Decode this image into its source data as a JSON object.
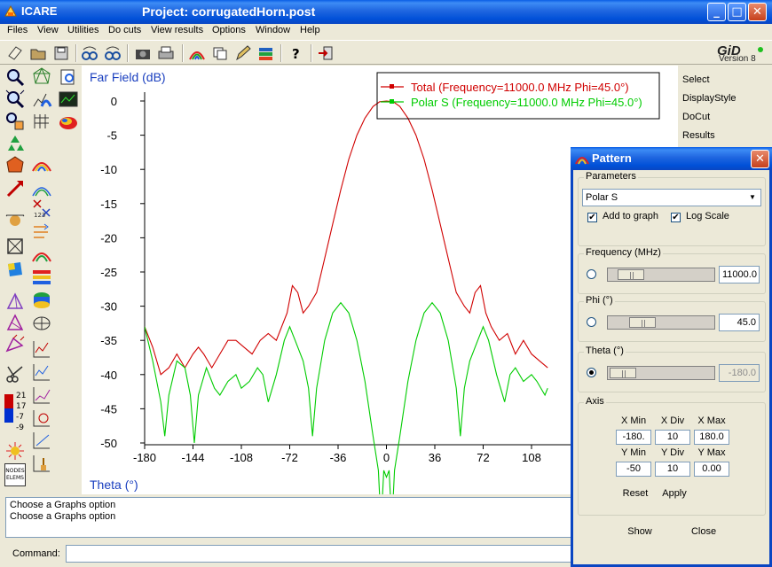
{
  "window": {
    "app_name": "ICARE",
    "project_title": "Project: corrugatedHorn.post",
    "minimize": "_",
    "maximize": "□",
    "close": "✕"
  },
  "menu": [
    "Files",
    "View",
    "Utilities",
    "Do cuts",
    "View results",
    "Options",
    "Window",
    "Help"
  ],
  "logo": {
    "brand": "GiD",
    "version": "Version 8"
  },
  "right_commands": [
    "Select",
    "DisplayStyle",
    "DoCut",
    "Results"
  ],
  "palette_labels": {
    "max": "21",
    "mid": "17",
    "low": "-7",
    "min": "-9",
    "nodes": "NODES",
    "elems": "ELEMS"
  },
  "chart_data": {
    "type": "line",
    "ylabel": "Far Field (dB)",
    "xlabel": "Theta (°)",
    "xlim": [
      -180,
      120
    ],
    "ylim": [
      -50,
      0
    ],
    "xticks": [
      -180,
      -144,
      -108,
      -72,
      -36,
      0,
      36,
      72,
      108
    ],
    "yticks": [
      0,
      -5,
      -10,
      -15,
      -20,
      -25,
      -30,
      -35,
      -40,
      -45,
      -50
    ],
    "legend_position": "top-center",
    "series": [
      {
        "name": "Total (Frequency=11000.0 MHz Phi=45.0°)",
        "color": "#d00000",
        "points": [
          [
            -180,
            -33
          ],
          [
            -174,
            -36
          ],
          [
            -168,
            -40
          ],
          [
            -162,
            -39
          ],
          [
            -156,
            -37
          ],
          [
            -150,
            -39
          ],
          [
            -144,
            -37
          ],
          [
            -140,
            -36
          ],
          [
            -136,
            -37
          ],
          [
            -130,
            -39
          ],
          [
            -124,
            -37
          ],
          [
            -118,
            -35
          ],
          [
            -112,
            -35
          ],
          [
            -106,
            -36
          ],
          [
            -100,
            -37
          ],
          [
            -94,
            -35
          ],
          [
            -88,
            -34
          ],
          [
            -82,
            -35
          ],
          [
            -78,
            -33
          ],
          [
            -74,
            -31
          ],
          [
            -70,
            -27
          ],
          [
            -66,
            -28
          ],
          [
            -62,
            -31
          ],
          [
            -58,
            -30
          ],
          [
            -52,
            -28
          ],
          [
            -46,
            -23
          ],
          [
            -40,
            -18
          ],
          [
            -34,
            -13
          ],
          [
            -28,
            -8.5
          ],
          [
            -22,
            -5
          ],
          [
            -16,
            -2.5
          ],
          [
            -10,
            -0.8
          ],
          [
            -5,
            -0.1
          ],
          [
            0,
            0
          ],
          [
            5,
            -0.1
          ],
          [
            10,
            -0.8
          ],
          [
            16,
            -2.5
          ],
          [
            22,
            -5
          ],
          [
            28,
            -8.5
          ],
          [
            34,
            -13
          ],
          [
            40,
            -18
          ],
          [
            46,
            -23
          ],
          [
            52,
            -28
          ],
          [
            58,
            -30
          ],
          [
            62,
            -31
          ],
          [
            66,
            -28
          ],
          [
            70,
            -27
          ],
          [
            74,
            -31
          ],
          [
            78,
            -33
          ],
          [
            84,
            -35
          ],
          [
            90,
            -34
          ],
          [
            96,
            -37
          ],
          [
            102,
            -35
          ],
          [
            108,
            -37
          ],
          [
            114,
            -38
          ],
          [
            120,
            -39
          ]
        ]
      },
      {
        "name": "Polar S (Frequency=11000.0 MHz Phi=45.0°)",
        "color": "#00cc00",
        "points": [
          [
            -180,
            -33
          ],
          [
            -174,
            -38
          ],
          [
            -168,
            -44
          ],
          [
            -165,
            -49
          ],
          [
            -162,
            -43
          ],
          [
            -156,
            -38
          ],
          [
            -150,
            -39
          ],
          [
            -146,
            -43
          ],
          [
            -143,
            -50
          ],
          [
            -140,
            -43
          ],
          [
            -134,
            -39
          ],
          [
            -128,
            -42
          ],
          [
            -124,
            -43
          ],
          [
            -118,
            -41
          ],
          [
            -112,
            -40
          ],
          [
            -108,
            -42
          ],
          [
            -102,
            -41
          ],
          [
            -96,
            -39
          ],
          [
            -92,
            -40
          ],
          [
            -88,
            -44
          ],
          [
            -82,
            -40
          ],
          [
            -76,
            -35
          ],
          [
            -72,
            -33
          ],
          [
            -68,
            -35
          ],
          [
            -62,
            -38
          ],
          [
            -58,
            -42
          ],
          [
            -55,
            -49
          ],
          [
            -52,
            -42
          ],
          [
            -46,
            -35
          ],
          [
            -40,
            -31
          ],
          [
            -34,
            -29.5
          ],
          [
            -28,
            -31
          ],
          [
            -22,
            -35
          ],
          [
            -16,
            -41
          ],
          [
            -10,
            -49
          ],
          [
            -6,
            -54
          ],
          [
            -4,
            -62
          ],
          [
            -2,
            -54
          ],
          [
            0,
            -55
          ],
          [
            2,
            -54
          ],
          [
            4,
            -62
          ],
          [
            6,
            -54
          ],
          [
            10,
            -49
          ],
          [
            16,
            -41
          ],
          [
            22,
            -35
          ],
          [
            28,
            -31
          ],
          [
            34,
            -29.5
          ],
          [
            40,
            -31
          ],
          [
            46,
            -35
          ],
          [
            52,
            -42
          ],
          [
            55,
            -49
          ],
          [
            58,
            -42
          ],
          [
            62,
            -38
          ],
          [
            68,
            -35
          ],
          [
            72,
            -33
          ],
          [
            76,
            -35
          ],
          [
            82,
            -40
          ],
          [
            88,
            -44
          ],
          [
            92,
            -40
          ],
          [
            96,
            -39
          ],
          [
            102,
            -41
          ],
          [
            108,
            -40
          ],
          [
            112,
            -41
          ],
          [
            118,
            -43
          ],
          [
            120,
            -42
          ]
        ]
      }
    ]
  },
  "messages": [
    "Choose a Graphs option",
    "Choose a Graphs option"
  ],
  "command": {
    "label": "Command:",
    "value": ""
  },
  "dialog": {
    "title": "Pattern",
    "close": "✕",
    "parameters_label": "Parameters",
    "parameter_selected": "Polar S",
    "add_to_graph_label": "Add to graph",
    "add_to_graph_checked": true,
    "log_scale_label": "Log Scale",
    "log_scale_checked": true,
    "frequency": {
      "label": "Frequency (MHz)",
      "value": "11000.0",
      "slider_fraction": 0.1
    },
    "phi": {
      "label": "Phi (°)",
      "value": "45.0",
      "slider_fraction": 0.25
    },
    "theta": {
      "label": "Theta (°)",
      "value": "-180.0",
      "slider_fraction": 0.0,
      "selected": true
    },
    "axis": {
      "label": "Axis",
      "xmin_label": "X Min",
      "xdiv_label": "X Div",
      "xmax_label": "X Max",
      "xmin": "-180.",
      "xdiv": "10",
      "xmax": "180.0",
      "ymin_label": "Y Min",
      "ydiv_label": "Y Div",
      "ymax_label": "Y Max",
      "ymin": "-50",
      "ydiv": "10",
      "ymax": "0.00"
    },
    "reset_label": "Reset",
    "apply_label": "Apply",
    "show_label": "Show",
    "close_label": "Close"
  }
}
